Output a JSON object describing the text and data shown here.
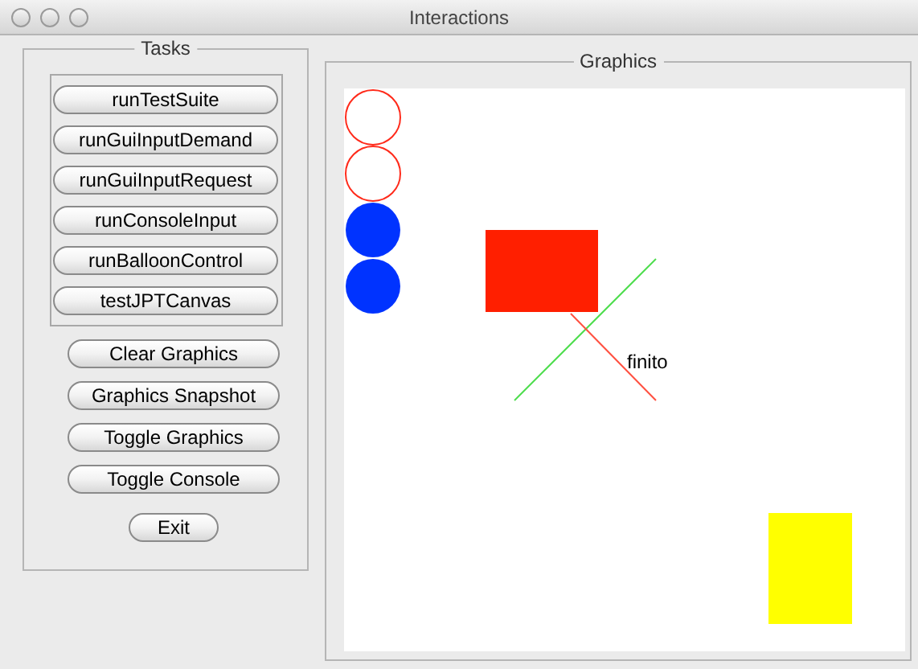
{
  "window": {
    "title": "Interactions"
  },
  "tasks": {
    "title": "Tasks",
    "task_buttons": [
      "runTestSuite",
      "runGuiInputDemand",
      "runGuiInputRequest",
      "runConsoleInput",
      "runBalloonControl",
      "testJPTCanvas"
    ],
    "graphics_buttons": [
      "Clear Graphics",
      "Graphics Snapshot",
      "Toggle Graphics",
      "Toggle Console"
    ],
    "exit_button": "Exit"
  },
  "graphics": {
    "title": "Graphics",
    "canvas_text": "finito"
  }
}
